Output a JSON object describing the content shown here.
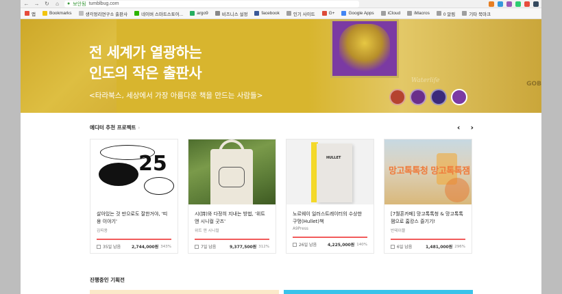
{
  "browser": {
    "url": "tumblbug.com",
    "security_label": "보안됨"
  },
  "bookmarks": [
    {
      "label": "앱",
      "color": "#e74c3c"
    },
    {
      "label": "Bookmarks",
      "color": "#f1c40f"
    },
    {
      "label": "생각정리연구소 출판사",
      "color": "#bdbdbd"
    },
    {
      "label": "네이버 스마트스토어...",
      "color": "#2db400"
    },
    {
      "label": "argo9",
      "color": "#27ae60"
    },
    {
      "label": "비즈니스 설정",
      "color": "#888888"
    },
    {
      "label": "facebook",
      "color": "#3b5998"
    },
    {
      "label": "인기 사이트",
      "color": "#9e9e9e"
    },
    {
      "label": "G+",
      "color": "#dd4b39"
    },
    {
      "label": "Google Apps",
      "color": "#4285f4"
    },
    {
      "label": "iCloud",
      "color": "#9e9e9e"
    },
    {
      "label": "iMacros",
      "color": "#9e9e9e"
    },
    {
      "label": "0 알림",
      "color": "#9e9e9e"
    },
    {
      "label": "기타 북마크",
      "color": "#9e9e9e"
    }
  ],
  "hero": {
    "title_line1": "전 세계가 열광하는",
    "title_line2": "인도의 작은 출판사",
    "subtitle": "<타라북스, 세상에서 가장 아름다운 책을 만드는 사람들>",
    "watermark": "Waterlife",
    "side_text": "GOB",
    "thumbnails": [
      {
        "color": "#b5432f",
        "active": false
      },
      {
        "color": "#6a2f8a",
        "active": false
      },
      {
        "color": "#3b2a7a",
        "active": false
      },
      {
        "color": "#7b3aa3",
        "active": true
      }
    ]
  },
  "section": {
    "title": "에디터 추천 프로젝트",
    "title_suffix": "›",
    "prev_label": "‹",
    "next_label": "›"
  },
  "cards": [
    {
      "title": "살아있는 것 만으로도 잘한거야, '띠용 이야기'",
      "author": "김띠용",
      "days": "35일 남음",
      "amount": "2,744,000원",
      "percent": "343%",
      "image_number": "25"
    },
    {
      "title": "시(詩)와 다정히 지내는 방법, '위트 앤 시니컬 굿즈'",
      "author": "위트 앤 시니컬",
      "days": "7일 남음",
      "amount": "9,377,500원",
      "percent": "312%"
    },
    {
      "title": "노르웨이 일러스트레이터의 수상한 구멍(Hullet)책",
      "author": "A9Press",
      "days": "26일 남음",
      "amount": "4,225,000원",
      "percent": "140%",
      "image_text": "HULLET"
    },
    {
      "title": "[7월혼카페] 망고톡톡청 & 망고톡톡잼으로 홈캉스 즐기기!",
      "author": "반테이블",
      "days": "6일 남음",
      "amount": "1,481,000원",
      "percent": "296%",
      "image_text": "망고톡톡청 망고톡톡잼"
    }
  ],
  "section2": {
    "title": "진행중인 기획전"
  }
}
